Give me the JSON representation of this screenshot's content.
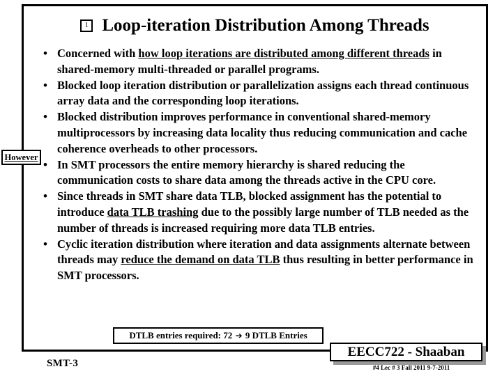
{
  "slide": {
    "title_marker": "1",
    "title": "Loop-iteration Distribution Among Threads",
    "bullet_char": "•",
    "bullets": [
      {
        "id": "bullet-concerned-with",
        "segments": [
          {
            "text": "Concerned with ",
            "underline": false
          },
          {
            "text": "how loop iterations are distributed among different threads",
            "underline": true
          },
          {
            "text": " in shared-memory multi-threaded or parallel programs.",
            "underline": false
          }
        ]
      },
      {
        "id": "bullet-blocked-distribution-assigns",
        "segments": [
          {
            "text": "Blocked loop iteration distribution or parallelization assigns each thread continuous array data and the corresponding loop iterations.",
            "underline": false
          }
        ]
      },
      {
        "id": "bullet-blocked-improves-performance",
        "segments": [
          {
            "text": "Blocked distribution improves performance in conventional shared-memory multiprocessors by  increasing data locality thus reducing communication and cache coherence overheads to other processors.",
            "underline": false
          }
        ]
      },
      {
        "id": "bullet-smt-memory-hierarchy-shared",
        "segments": [
          {
            "text": "In SMT processors the entire memory hierarchy  is shared reducing the communication costs to share data among the threads active in the CPU core.",
            "underline": false
          }
        ]
      },
      {
        "id": "bullet-smt-share-data-tlb",
        "segments": [
          {
            "text": "Since threads in SMT share data TLB, blocked assignment  has the potential to introduce ",
            "underline": false
          },
          {
            "text": "data TLB trashing",
            "underline": true
          },
          {
            "text": " due to the possibly large number of TLB needed as the number of threads is increased requiring more data TLB entries.",
            "underline": false
          }
        ]
      },
      {
        "id": "bullet-cyclic-iteration-distribution",
        "segments": [
          {
            "text": "Cyclic iteration distribution where iteration and data assignments alternate between threads may ",
            "underline": false
          },
          {
            "text": "reduce the demand on data TLB",
            "underline": true
          },
          {
            "text": " thus resulting in better performance in SMT processors.",
            "underline": false
          }
        ]
      }
    ],
    "however_callout": "However",
    "dtlb_note": {
      "prefix": "DTLB entries required:  72 ",
      "arrow": "➔",
      "suffix": " 9  DTLB Entries"
    },
    "footer": {
      "left_label": "SMT-3",
      "course_badge": "EECC722 - Shaaban",
      "meta": "#4   Lec # 3   Fall 2011  9-7-2011"
    }
  }
}
